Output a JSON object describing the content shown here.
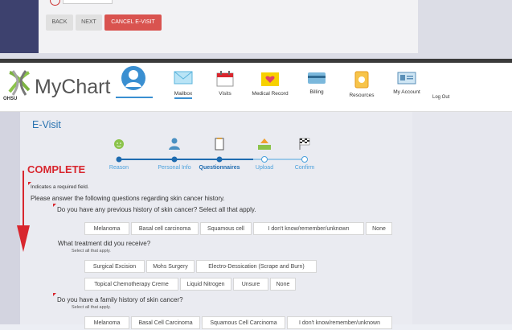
{
  "top_section": {
    "back_label": "BACK",
    "next_label": "NEXT",
    "cancel_label": "CANCEL E-VISIT"
  },
  "header": {
    "logo_text": "MyChart",
    "logo_sub": "OHSU",
    "nav": [
      {
        "label": "Mailbox",
        "icon": "mail-icon"
      },
      {
        "label": "Visits",
        "icon": "calendar-icon"
      },
      {
        "label": "Medical Record",
        "icon": "heart-folder-icon"
      },
      {
        "label": "Billing",
        "icon": "credit-card-icon"
      },
      {
        "label": "Resources",
        "icon": "resources-icon"
      },
      {
        "label": "My Account",
        "icon": "id-card-icon"
      }
    ],
    "logout": "Log Out"
  },
  "evisit": {
    "title": "E-Visit",
    "annotation": "COMPLETE",
    "steps": [
      "Reason",
      "Personal Info",
      "Questionnaires",
      "Upload",
      "Confirm"
    ],
    "current_step_index": 2,
    "required_note": "Indicates a required field.",
    "intro": "Please answer the following questions regarding skin cancer history."
  },
  "questions": {
    "q1": {
      "text": "Do you have any previous history of skin cancer? Select all that apply.",
      "options": [
        "Melanoma",
        "Basal cell carcinoma",
        "Squamous cell",
        "I don't know/remember/unknown",
        "None"
      ]
    },
    "q2": {
      "text": "What treatment did you receive?",
      "sub": "Select all that apply.",
      "options_row1": [
        "Surgical Excision",
        "Mohs Surgery",
        "Electro-Dessication (Scrape and Burn)"
      ],
      "options_row2": [
        "Topical Chemotherapy Creme",
        "Liquid Nitrogen",
        "Unsure",
        "None"
      ]
    },
    "q3": {
      "text": "Do you have a family history of skin cancer?",
      "sub": "Select all that apply.",
      "options": [
        "Melanoma",
        "Basal Cell Carcinoma",
        "Squamous Cell Carcinoma",
        "I don't know/remember/unknown"
      ]
    }
  },
  "colors": {
    "accent": "#2a73b0",
    "annotation_red": "#d8262e",
    "cancel_red": "#d9534f"
  }
}
